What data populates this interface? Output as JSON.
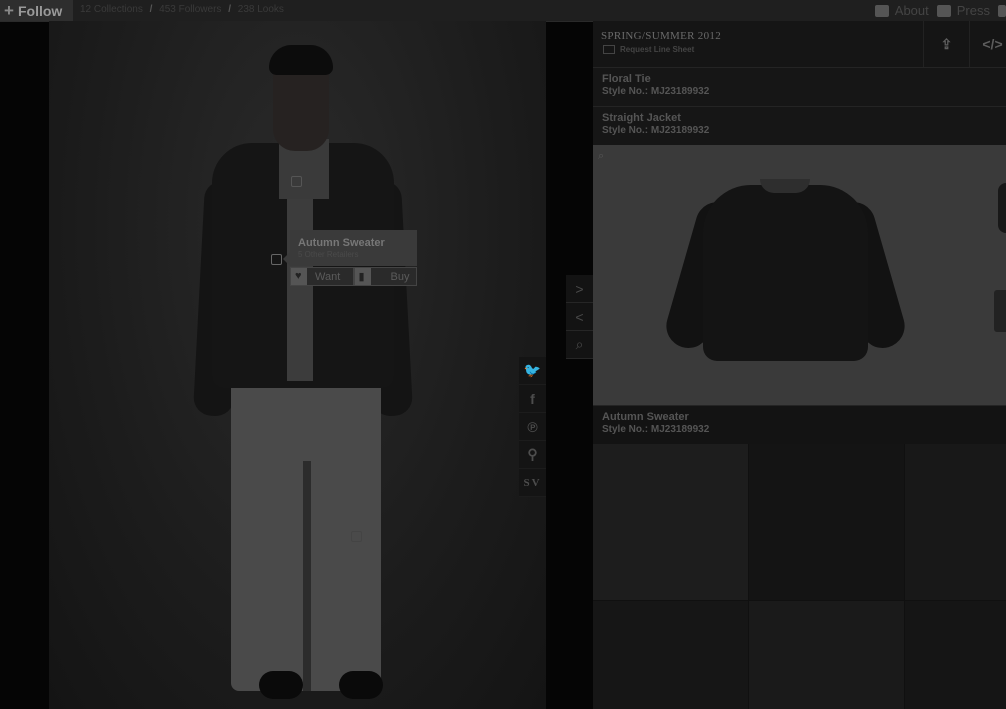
{
  "topbar": {
    "follow_label": "Follow",
    "plus_glyph": "+",
    "breadcrumbs": [
      "12 Collections",
      "453 Followers",
      "238 Looks"
    ],
    "separator": "/",
    "about_label": "About",
    "press_label": "Press"
  },
  "look": {
    "tooltip": {
      "title": "Autumn Sweater",
      "subtitle": "5 Other Retailers",
      "want_label": "Want",
      "buy_label": "Buy"
    }
  },
  "social": {
    "icons": [
      "twitter-icon",
      "facebook-icon",
      "pinterest-icon",
      "pin-icon",
      "sv-icon"
    ],
    "glyphs": [
      "🐦",
      "f",
      "℗",
      "⚲",
      "SV"
    ]
  },
  "nav": {
    "next_glyph": ">",
    "prev_glyph": "<",
    "zoom_glyph": "⌕"
  },
  "panel": {
    "season": "SPRING/SUMMER 2012",
    "request_label": "Request Line Sheet",
    "share_glyph": "⇪",
    "embed_glyph": "</>",
    "items": [
      {
        "name": "Floral Tie",
        "style": "Style No.: MJ23189932"
      },
      {
        "name": "Straight Jacket",
        "style": "Style No.: MJ23189932"
      },
      {
        "name": "Autumn Sweater",
        "style": "Style No.: MJ23189932"
      }
    ],
    "preview_zoom_glyph": "⌕"
  },
  "colors": {
    "overlay_bg": "#050505",
    "panel_bg": "#101010",
    "preview_bg": "#3a3a3a"
  }
}
